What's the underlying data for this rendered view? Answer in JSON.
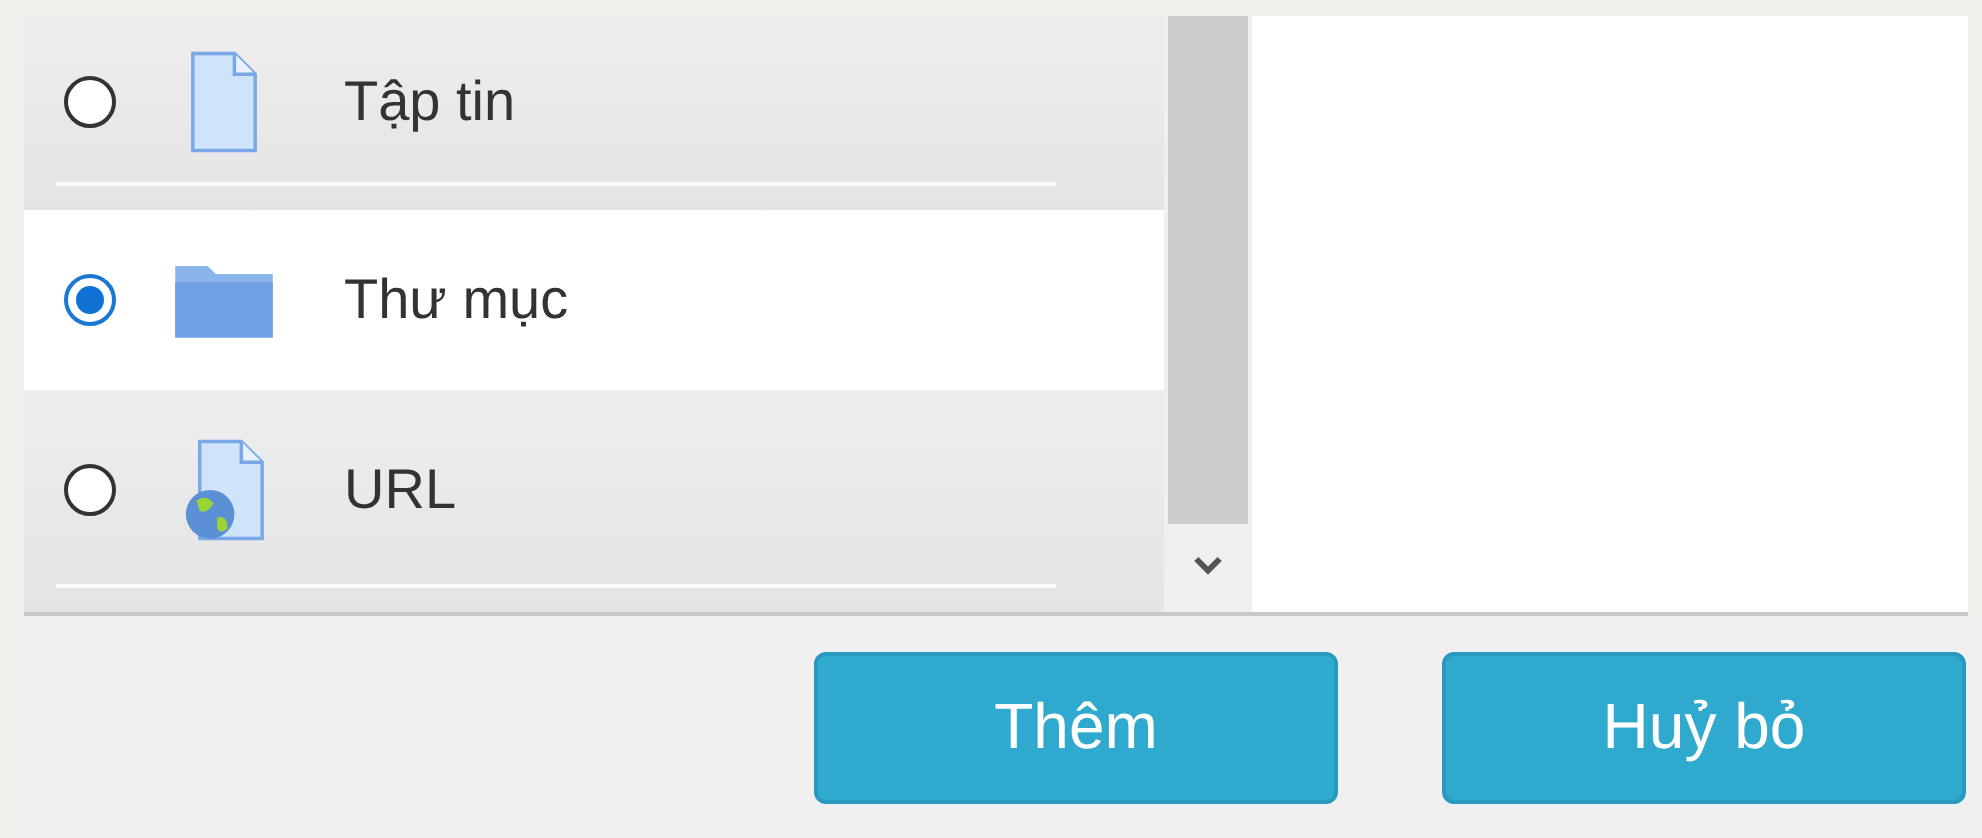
{
  "options": [
    {
      "label": "Tập tin",
      "kind": "file",
      "selected": false
    },
    {
      "label": "Thư mục",
      "kind": "folder",
      "selected": true
    },
    {
      "label": "URL",
      "kind": "url",
      "selected": false
    }
  ],
  "buttons": [
    "Thêm",
    "Huỷ bỏ"
  ]
}
